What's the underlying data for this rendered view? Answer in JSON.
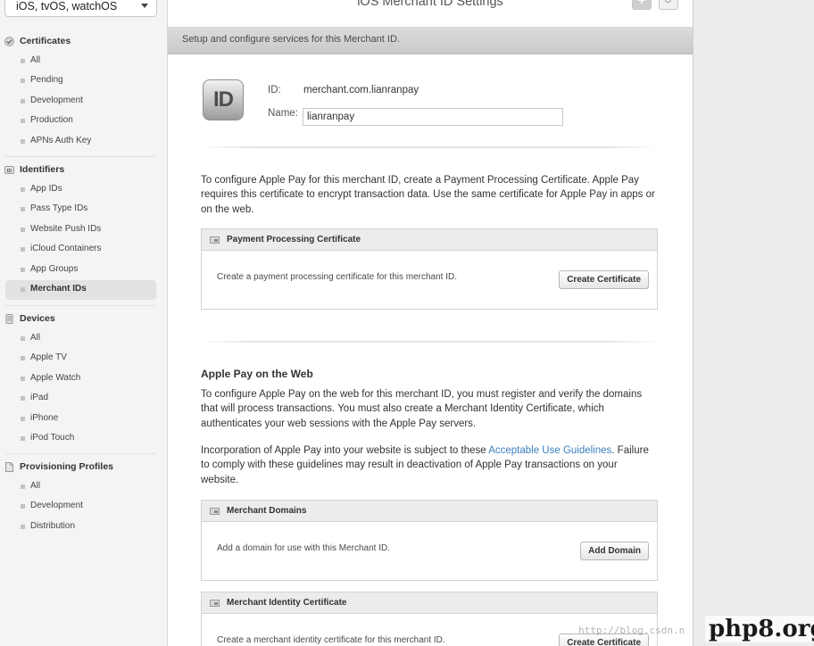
{
  "sidebar": {
    "platform_select": "iOS, tvOS, watchOS",
    "sections": [
      {
        "title": "Certificates",
        "icon": "check-badge-icon",
        "items": [
          "All",
          "Pending",
          "Development",
          "Production",
          "APNs Auth Key"
        ]
      },
      {
        "title": "Identifiers",
        "icon": "id-badge-icon",
        "items": [
          "App IDs",
          "Pass Type IDs",
          "Website Push IDs",
          "iCloud Containers",
          "App Groups",
          "Merchant IDs"
        ],
        "active": "Merchant IDs"
      },
      {
        "title": "Devices",
        "icon": "device-icon",
        "items": [
          "All",
          "Apple TV",
          "Apple Watch",
          "iPad",
          "iPhone",
          "iPod Touch"
        ]
      },
      {
        "title": "Provisioning Profiles",
        "icon": "document-icon",
        "items": [
          "All",
          "Development",
          "Distribution"
        ]
      }
    ]
  },
  "header": {
    "title": "iOS Merchant ID Settings",
    "add_label": "+",
    "banner": "Setup and configure services for this Merchant ID."
  },
  "merchant": {
    "icon_text": "ID",
    "id_label": "ID:",
    "id_value": "merchant.com.lianranpay",
    "name_label": "Name:",
    "name_value": "lianranpay"
  },
  "payment": {
    "intro": "To configure Apple Pay for this merchant ID, create a Payment Processing Certificate. Apple Pay requires this certificate to encrypt transaction data. Use the same certificate for Apple Pay in apps or on the web.",
    "panel_title": "Payment Processing Certificate",
    "panel_text": "Create a payment processing certificate for this merchant ID.",
    "button": "Create Certificate"
  },
  "web": {
    "heading": "Apple Pay on the Web",
    "para1": "To configure Apple Pay on the web for this merchant ID, you must register and verify the domains that will process transactions. You must also create a Merchant Identity Certificate, which authenticates your web sessions with the Apple Pay servers.",
    "para2_before": "Incorporation of Apple Pay into your website is subject to these ",
    "para2_link": "Acceptable Use Guidelines",
    "para2_after": ". Failure to comply with these guidelines may result in deactivation of Apple Pay transactions on your website.",
    "domains_title": "Merchant Domains",
    "domains_text": "Add a domain for use with this Merchant ID.",
    "domains_button": "Add Domain",
    "identity_title": "Merchant Identity Certificate",
    "identity_text": "Create a merchant identity certificate for this merchant ID.",
    "identity_button": "Create Certificate"
  },
  "watermark": {
    "url": "http://blog.csdn.n",
    "logo": "php8.org"
  },
  "colors": {
    "link": "#3a7ebf",
    "banner": "#cfcfcf",
    "sidebar_bg": "#f4f4f4"
  }
}
